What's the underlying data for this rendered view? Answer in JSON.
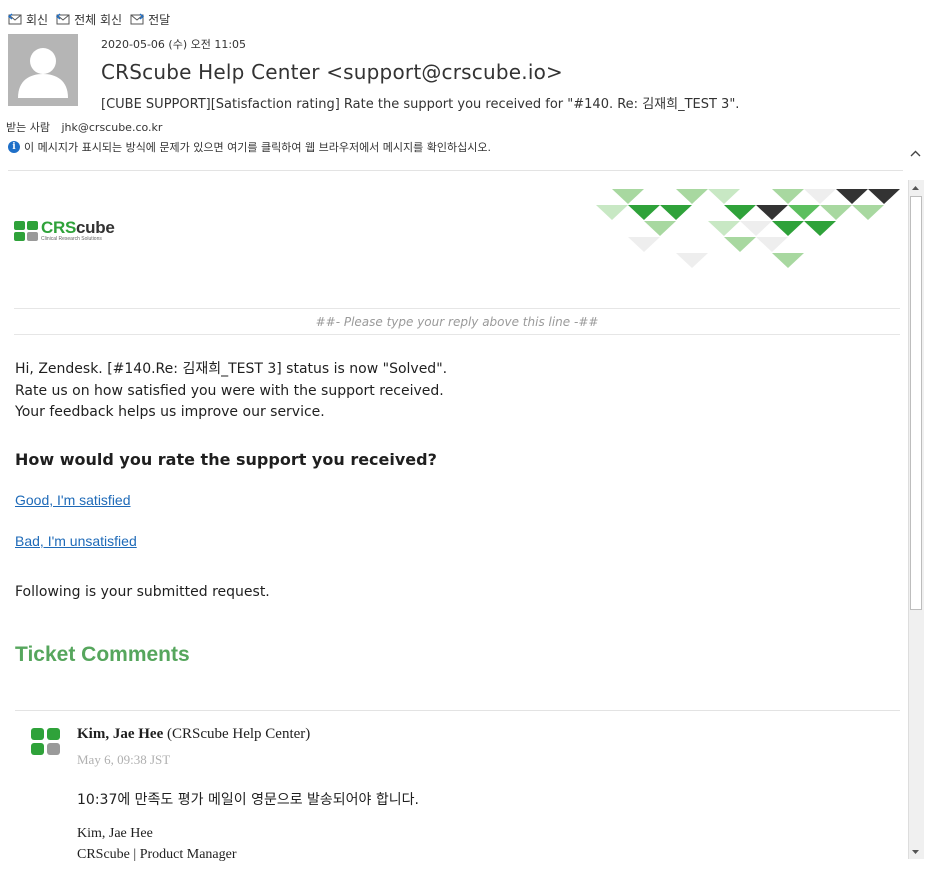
{
  "toolbar": {
    "reply": "회신",
    "reply_all": "전체 회신",
    "forward": "전달"
  },
  "message": {
    "date": "2020-05-06 (수) 오전 11:05",
    "sender": "CRScube Help Center <support@crscube.io>",
    "subject": "[CUBE SUPPORT][Satisfaction rating] Rate the support you received for \"#140. Re: 김재희_TEST 3\".",
    "to_label": "받는 사람",
    "to_address": "jhk@crscube.co.kr",
    "info_notice": "이 메시지가 표시되는 방식에 문제가 있으면 여기를 클릭하여 웹 브라우저에서 메시지를 확인하십시오."
  },
  "email": {
    "logo_main_green": "CRS",
    "logo_main_dark": "cube",
    "logo_sub": "Clinical Research Solutions",
    "reply_marker": "##- Please type your reply above this line -##",
    "intro_line1": "Hi, Zendesk. [#140.Re: 김재희_TEST 3] status is now \"Solved\".",
    "intro_line2": "Rate us on how satisfied you were with the support received.",
    "intro_line3": "Your feedback helps us improve our service.",
    "question": "How would you rate the support you received?",
    "good_link": "Good, I'm satisfied",
    "bad_link": "Bad, I'm unsatisfied",
    "following": "Following is your submitted request.",
    "comments_title": "Ticket Comments"
  },
  "comment": {
    "author": "Kim, Jae Hee",
    "org": "(CRScube Help Center)",
    "date": "May 6, 09:38 JST",
    "text": "10:37에 만족도 평가 메일이 영문으로 발송되어야 합니다.",
    "sig_name": "Kim, Jae Hee",
    "sig_title": "CRScube | Product Manager"
  },
  "colors": {
    "brand_green": "#2fa23a",
    "title_green": "#56a65d",
    "link_blue": "#1e6ab8",
    "light_green": "#a8d8a0",
    "mid_green": "#5cbf5f",
    "dark": "#333333",
    "light_gray": "#e6e6e6"
  },
  "icons": {
    "reply": "envelope-reply-icon",
    "reply_all": "envelope-reply-all-icon",
    "forward": "envelope-forward-icon",
    "info": "info-icon",
    "collapse": "chevron-up-icon"
  }
}
